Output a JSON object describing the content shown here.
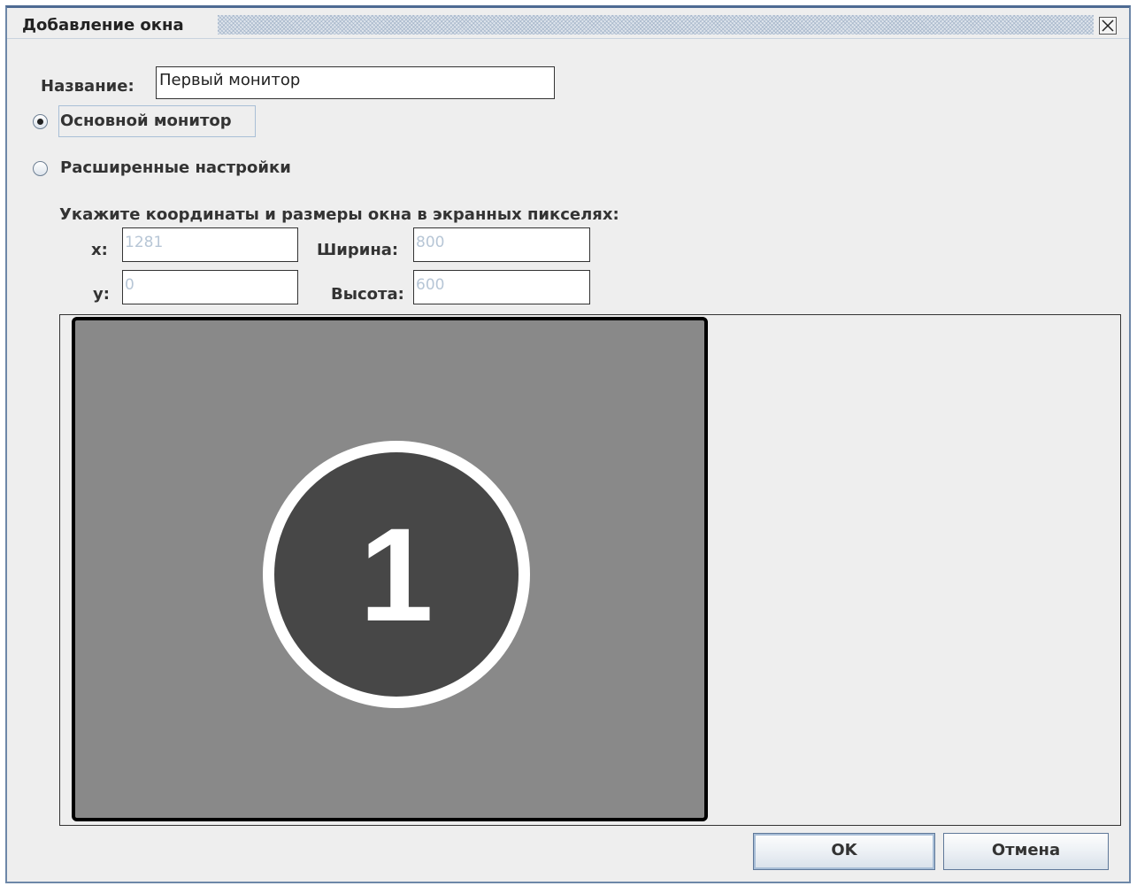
{
  "dialog": {
    "title": "Добавление окна",
    "close_icon": "close-icon"
  },
  "name": {
    "label": "Название:",
    "value": "Первый монитор"
  },
  "mode": {
    "options": [
      {
        "label": "Основной монитор",
        "selected": true
      },
      {
        "label": "Расширенные настройки",
        "selected": false
      }
    ]
  },
  "geometry": {
    "instruction": "Укажите координаты и размеры окна в экранных пикселях:",
    "x_label": "x:",
    "x_value": "1281",
    "y_label": "y:",
    "y_value": "0",
    "width_label": "Ширина:",
    "width_value": "800",
    "height_label": "Высота:",
    "height_value": "600"
  },
  "preview": {
    "monitor_number": "1"
  },
  "buttons": {
    "ok": "OK",
    "cancel": "Отмена"
  }
}
